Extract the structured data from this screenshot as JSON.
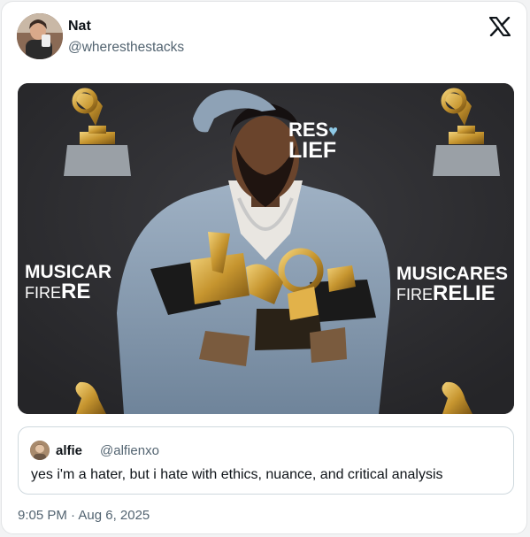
{
  "post": {
    "author": {
      "name": "Nat",
      "handle": "@wheresthestacks"
    },
    "timestamp": "9:05 PM · Aug 6, 2025"
  },
  "media": {
    "backdrop": {
      "left_line1": "MUSICAR",
      "left_line2a": "FIRE",
      "left_line2b": "RE",
      "right_line1": "MUSICARES",
      "right_line2a": "FIRE",
      "right_line2b": "RELIE",
      "center_line1": "RES",
      "center_line2": "LIEF"
    }
  },
  "quoted_post": {
    "author": {
      "name": "alfie",
      "handle": "@alfienxo"
    },
    "text": "yes i'm a hater, but i hate with ethics, nuance, and critical analysis"
  },
  "colors": {
    "text": "#0f1419",
    "secondary": "#536471",
    "border": "#cfd9de"
  },
  "icons": {
    "brand": "x-logo-icon",
    "award": "gramophone-icon"
  }
}
